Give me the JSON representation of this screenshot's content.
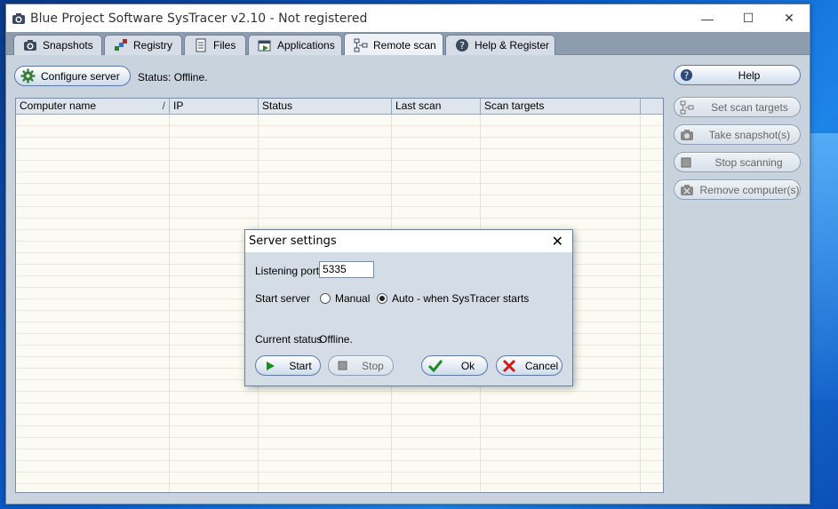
{
  "window": {
    "title": "Blue Project Software SysTracer v2.10 - Not registered",
    "controls": {
      "minimize": "—",
      "maximize": "☐",
      "close": "✕"
    }
  },
  "tabs": [
    {
      "label": "Snapshots",
      "icon": "camera-icon"
    },
    {
      "label": "Registry",
      "icon": "registry-icon"
    },
    {
      "label": "Files",
      "icon": "files-icon"
    },
    {
      "label": "Applications",
      "icon": "applications-icon"
    },
    {
      "label": "Remote scan",
      "icon": "network-icon",
      "active": true
    },
    {
      "label": "Help & Register",
      "icon": "help-icon"
    }
  ],
  "toolbar": {
    "configure_label": "Configure server",
    "status_text": "Status: Offline."
  },
  "grid": {
    "columns": [
      "Computer name",
      "IP",
      "Status",
      "Last scan",
      "Scan targets"
    ],
    "sort_indicator": "/"
  },
  "side_buttons": {
    "help": "Help",
    "set_scan_targets": "Set scan targets",
    "take_snapshot": "Take snapshot(s)",
    "stop_scanning": "Stop scanning",
    "remove_computer": "Remove computer(s)"
  },
  "dialog": {
    "title": "Server settings",
    "close": "✕",
    "listening_port_label": "Listening port",
    "listening_port_value": "5335",
    "start_server_label": "Start server",
    "radio_manual": "Manual",
    "radio_auto": "Auto - when SysTracer starts",
    "selected": "auto",
    "current_status_label": "Current status",
    "current_status_value": "Offline.",
    "start_label": "Start",
    "stop_label": "Stop",
    "ok_label": "Ok",
    "cancel_label": "Cancel"
  },
  "colors": {
    "window_bg": "#c9d3de",
    "tabs_bg": "#8e9cb0",
    "grid_bg": "#fbfbf4",
    "ok_check": "#1f8a1f",
    "cancel_x": "#d01a1a"
  }
}
